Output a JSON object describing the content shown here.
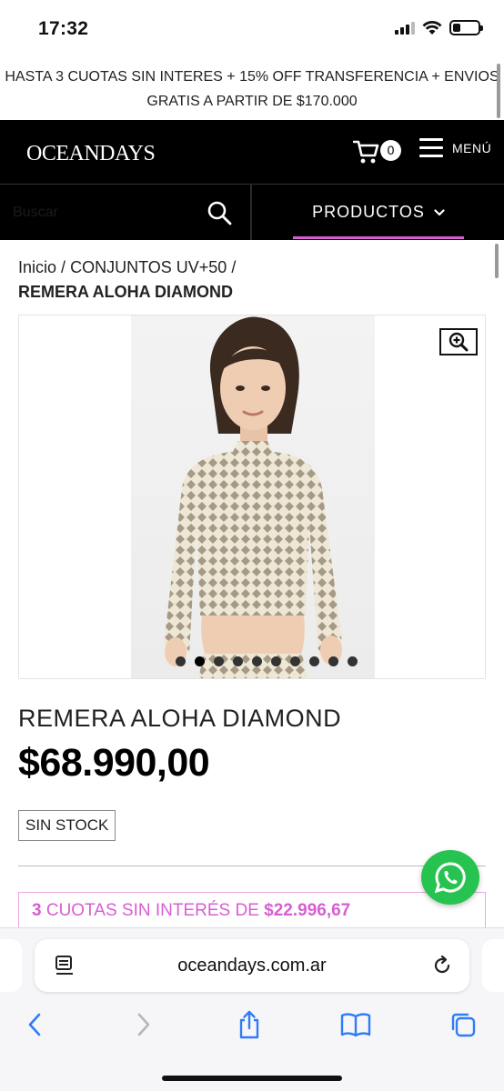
{
  "status_bar": {
    "time": "17:32"
  },
  "promo": {
    "line1": "HASTA 3 CUOTAS SIN INTERES + 15% OFF TRANSFERENCIA + ENVIOS",
    "line2": "GRATIS A PARTIR DE $170.000"
  },
  "header": {
    "logo": "OCEANDAYS",
    "cart_count": "0",
    "menu_label": "MENÚ"
  },
  "search": {
    "placeholder": "Buscar"
  },
  "nav": {
    "products_label": "PRODUCTOS"
  },
  "breadcrumb": {
    "home": "Inicio",
    "separator": "/",
    "category": "CONJUNTOS UV+50",
    "current": "REMERA ALOHA DIAMOND"
  },
  "gallery": {
    "image_count": 10,
    "active_index": 1
  },
  "product": {
    "title": "REMERA ALOHA DIAMOND",
    "price": "$68.990,00",
    "stock": "SIN STOCK"
  },
  "installments": {
    "count": "3",
    "text": "CUOTAS SIN INTERÉS DE",
    "amount": "$22.996,67"
  },
  "browser": {
    "url": "oceandays.com.ar"
  },
  "colors": {
    "accent": "#d85ed2",
    "header_bg": "#000000",
    "whatsapp": "#27c350"
  }
}
